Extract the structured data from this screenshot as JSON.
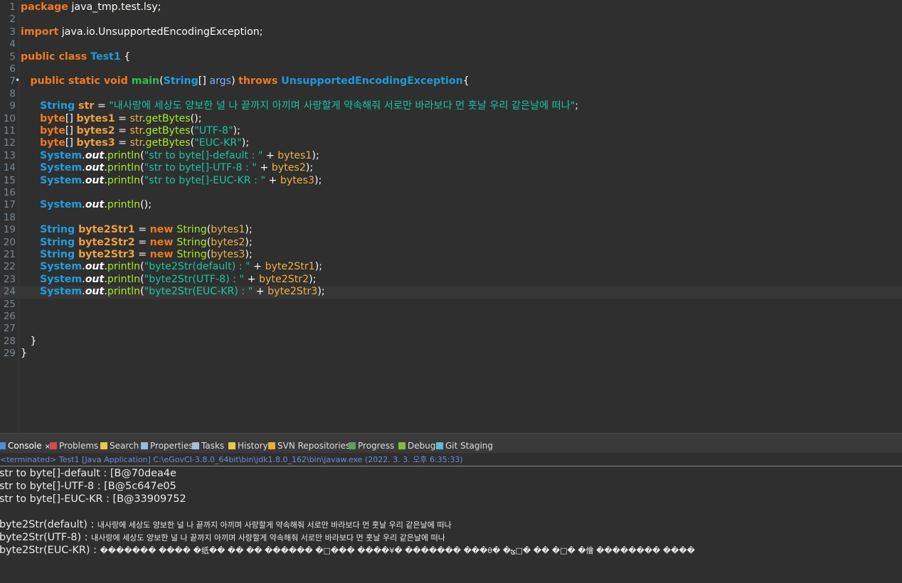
{
  "editor": {
    "lines": [
      {
        "n": "1",
        "tokens": [
          [
            "kw",
            "package"
          ],
          [
            "pl",
            " java_tmp.test.lsy;"
          ]
        ]
      },
      {
        "n": "2",
        "tokens": []
      },
      {
        "n": "3",
        "tokens": [
          [
            "kw",
            "import"
          ],
          [
            "pl",
            " java.io.UnsupportedEncodingException;"
          ]
        ]
      },
      {
        "n": "4",
        "tokens": []
      },
      {
        "n": "5",
        "tokens": [
          [
            "kw",
            "public class "
          ],
          [
            "cls",
            "Test1"
          ],
          [
            "pl",
            " {"
          ]
        ]
      },
      {
        "n": "6",
        "tokens": []
      },
      {
        "n": "7",
        "mark": "•",
        "tokens": [
          [
            "pl",
            "   "
          ],
          [
            "kw",
            "public static void "
          ],
          [
            "fn",
            "main"
          ],
          [
            "pl",
            "("
          ],
          [
            "ty",
            "String"
          ],
          [
            "pl",
            "[] "
          ],
          [
            "par",
            "args"
          ],
          [
            "pl",
            ") "
          ],
          [
            "kw",
            "throws "
          ],
          [
            "cls",
            "UnsupportedEncodingException"
          ],
          [
            "pl",
            "{"
          ]
        ]
      },
      {
        "n": "8",
        "tokens": []
      },
      {
        "n": "9",
        "tokens": [
          [
            "pl",
            "      "
          ],
          [
            "ty",
            "String "
          ],
          [
            "var",
            "str"
          ],
          [
            "pl",
            " = "
          ],
          [
            "str",
            "\"내사랑에 세상도 양보한 널 나 끝까지 아끼며 사랑할게 약속해줘 서로만 바라보다 먼 훗날 우리 같은날에 떠나\""
          ],
          [
            "pl",
            ";"
          ]
        ]
      },
      {
        "n": "10",
        "tokens": [
          [
            "pl",
            "      "
          ],
          [
            "kw",
            "byte"
          ],
          [
            "pl",
            "[] "
          ],
          [
            "var",
            "bytes1"
          ],
          [
            "pl",
            " = "
          ],
          [
            "varp",
            "str"
          ],
          [
            "pl",
            "."
          ],
          [
            "m",
            "getBytes"
          ],
          [
            "pl",
            "();"
          ]
        ]
      },
      {
        "n": "11",
        "tokens": [
          [
            "pl",
            "      "
          ],
          [
            "kw",
            "byte"
          ],
          [
            "pl",
            "[] "
          ],
          [
            "var",
            "bytes2"
          ],
          [
            "pl",
            " = "
          ],
          [
            "varp",
            "str"
          ],
          [
            "pl",
            "."
          ],
          [
            "m",
            "getBytes"
          ],
          [
            "pl",
            "("
          ],
          [
            "str",
            "\"UTF-8\""
          ],
          [
            "pl",
            ");"
          ]
        ]
      },
      {
        "n": "12",
        "tokens": [
          [
            "pl",
            "      "
          ],
          [
            "kw",
            "byte"
          ],
          [
            "pl",
            "[] "
          ],
          [
            "var",
            "bytes3"
          ],
          [
            "pl",
            " = "
          ],
          [
            "varp",
            "str"
          ],
          [
            "pl",
            "."
          ],
          [
            "m",
            "getBytes"
          ],
          [
            "pl",
            "("
          ],
          [
            "str",
            "\"EUC-KR\""
          ],
          [
            "pl",
            ");"
          ]
        ]
      },
      {
        "n": "13",
        "tokens": [
          [
            "pl",
            "      "
          ],
          [
            "ty",
            "System"
          ],
          [
            "pl",
            "."
          ],
          [
            "it",
            "out"
          ],
          [
            "pl",
            "."
          ],
          [
            "m",
            "println"
          ],
          [
            "pl",
            "("
          ],
          [
            "str",
            "\"str to byte[]-default : \""
          ],
          [
            "pl",
            " + "
          ],
          [
            "varp",
            "bytes1"
          ],
          [
            "pl",
            ");"
          ]
        ]
      },
      {
        "n": "14",
        "tokens": [
          [
            "pl",
            "      "
          ],
          [
            "ty",
            "System"
          ],
          [
            "pl",
            "."
          ],
          [
            "it",
            "out"
          ],
          [
            "pl",
            "."
          ],
          [
            "m",
            "println"
          ],
          [
            "pl",
            "("
          ],
          [
            "str",
            "\"str to byte[]-UTF-8 : \""
          ],
          [
            "pl",
            " + "
          ],
          [
            "varp",
            "bytes2"
          ],
          [
            "pl",
            ");"
          ]
        ]
      },
      {
        "n": "15",
        "tokens": [
          [
            "pl",
            "      "
          ],
          [
            "ty",
            "System"
          ],
          [
            "pl",
            "."
          ],
          [
            "it",
            "out"
          ],
          [
            "pl",
            "."
          ],
          [
            "m",
            "println"
          ],
          [
            "pl",
            "("
          ],
          [
            "str",
            "\"str to byte[]-EUC-KR : \""
          ],
          [
            "pl",
            " + "
          ],
          [
            "varp",
            "bytes3"
          ],
          [
            "pl",
            ");"
          ]
        ]
      },
      {
        "n": "16",
        "tokens": []
      },
      {
        "n": "17",
        "tokens": [
          [
            "pl",
            "      "
          ],
          [
            "ty",
            "System"
          ],
          [
            "pl",
            "."
          ],
          [
            "it",
            "out"
          ],
          [
            "pl",
            "."
          ],
          [
            "m",
            "println"
          ],
          [
            "pl",
            "();"
          ]
        ]
      },
      {
        "n": "18",
        "tokens": []
      },
      {
        "n": "19",
        "tokens": [
          [
            "pl",
            "      "
          ],
          [
            "ty",
            "String "
          ],
          [
            "var",
            "byte2Str1"
          ],
          [
            "pl",
            " = "
          ],
          [
            "kw",
            "new "
          ],
          [
            "m",
            "String"
          ],
          [
            "pl",
            "("
          ],
          [
            "varp",
            "bytes1"
          ],
          [
            "pl",
            ");"
          ]
        ]
      },
      {
        "n": "20",
        "tokens": [
          [
            "pl",
            "      "
          ],
          [
            "ty",
            "String "
          ],
          [
            "var",
            "byte2Str2"
          ],
          [
            "pl",
            " = "
          ],
          [
            "kw",
            "new "
          ],
          [
            "m",
            "String"
          ],
          [
            "pl",
            "("
          ],
          [
            "varp",
            "bytes2"
          ],
          [
            "pl",
            ");"
          ]
        ]
      },
      {
        "n": "21",
        "tokens": [
          [
            "pl",
            "      "
          ],
          [
            "ty",
            "String "
          ],
          [
            "var",
            "byte2Str3"
          ],
          [
            "pl",
            " = "
          ],
          [
            "kw",
            "new "
          ],
          [
            "m",
            "String"
          ],
          [
            "pl",
            "("
          ],
          [
            "varp",
            "bytes3"
          ],
          [
            "pl",
            ");"
          ]
        ]
      },
      {
        "n": "22",
        "tokens": [
          [
            "pl",
            "      "
          ],
          [
            "ty",
            "System"
          ],
          [
            "pl",
            "."
          ],
          [
            "it",
            "out"
          ],
          [
            "pl",
            "."
          ],
          [
            "m",
            "println"
          ],
          [
            "pl",
            "("
          ],
          [
            "str",
            "\"byte2Str(default) : \""
          ],
          [
            "pl",
            " + "
          ],
          [
            "varp",
            "byte2Str1"
          ],
          [
            "pl",
            ");"
          ]
        ]
      },
      {
        "n": "23",
        "tokens": [
          [
            "pl",
            "      "
          ],
          [
            "ty",
            "System"
          ],
          [
            "pl",
            "."
          ],
          [
            "it",
            "out"
          ],
          [
            "pl",
            "."
          ],
          [
            "m",
            "println"
          ],
          [
            "pl",
            "("
          ],
          [
            "str",
            "\"byte2Str(UTF-8) : \""
          ],
          [
            "pl",
            " + "
          ],
          [
            "varp",
            "byte2Str2"
          ],
          [
            "pl",
            ");"
          ]
        ]
      },
      {
        "n": "24",
        "current": true,
        "tokens": [
          [
            "pl",
            "      "
          ],
          [
            "ty",
            "System"
          ],
          [
            "pl",
            "."
          ],
          [
            "it",
            "out"
          ],
          [
            "pl",
            "."
          ],
          [
            "m",
            "println"
          ],
          [
            "pl",
            "("
          ],
          [
            "str",
            "\"byte2Str(EUC-KR) : \""
          ],
          [
            "pl",
            " + "
          ],
          [
            "varp",
            "byte2Str3"
          ],
          [
            "pl",
            ");"
          ]
        ]
      },
      {
        "n": "25",
        "tokens": []
      },
      {
        "n": "26",
        "tokens": []
      },
      {
        "n": "27",
        "tokens": []
      },
      {
        "n": "28",
        "tokens": [
          [
            "pl",
            "   }"
          ]
        ]
      },
      {
        "n": "29",
        "tokens": [
          [
            "pl",
            "}"
          ]
        ]
      }
    ]
  },
  "tabs": [
    {
      "label": "Console",
      "icon": "console-icon",
      "color": "#4a90d9",
      "active": true,
      "close": "×"
    },
    {
      "label": "Problems",
      "icon": "problems-icon",
      "color": "#d94a4a"
    },
    {
      "label": "Search",
      "icon": "search-icon",
      "color": "#e8c84a"
    },
    {
      "label": "Properties",
      "icon": "properties-icon",
      "color": "#9ab8e0"
    },
    {
      "label": "Tasks",
      "icon": "tasks-icon",
      "color": "#a0c0e0"
    },
    {
      "label": "History",
      "icon": "history-icon",
      "color": "#e8c84a"
    },
    {
      "label": "SVN Repositories",
      "icon": "svn-repositories-icon",
      "color": "#e8b030"
    },
    {
      "label": "Progress",
      "icon": "progress-icon",
      "color": "#5fa05f"
    },
    {
      "label": "Debug",
      "icon": "debug-icon",
      "color": "#7fbf3f"
    },
    {
      "label": "Git Staging",
      "icon": "git-staging-icon",
      "color": "#5fb8e0"
    }
  ],
  "console": {
    "header": "<terminated> Test1 [Java Application] C:\\eGovCI-3.8.0_64bit\\bin\\jdk1.8.0_162\\bin\\javaw.exe (2022. 3. 3. 오후 6:35:33)",
    "output": [
      {
        "label": "str to byte[]-default : [B@70dea4e",
        "value": ""
      },
      {
        "label": "str to byte[]-UTF-8 : [B@5c647e05",
        "value": ""
      },
      {
        "label": "str to byte[]-EUC-KR : [B@33909752",
        "value": ""
      },
      {
        "label": "",
        "value": ""
      },
      {
        "label": "byte2Str(default) : ",
        "value": "내사랑에 세상도 양보한 널 나 끝까지 아끼며 사랑할게 약속해줘 서로만 바라보다 먼 훗날 우리 같은날에 떠나"
      },
      {
        "label": "byte2Str(UTF-8) : ",
        "value": "내사랑에 세상도 양보한 널 나 끝까지 아끼며 사랑할게 약속해줘 서로만 바라보다 먼 훗날 우리 같은날에 떠나"
      },
      {
        "label": "byte2Str(EUC-KR) : ",
        "value": "������� ���� �纸�� �� �� ������ �□��� ����¥� ������� ���θ� �ؿ□� �� �□� �儈 �������� ����"
      }
    ]
  }
}
